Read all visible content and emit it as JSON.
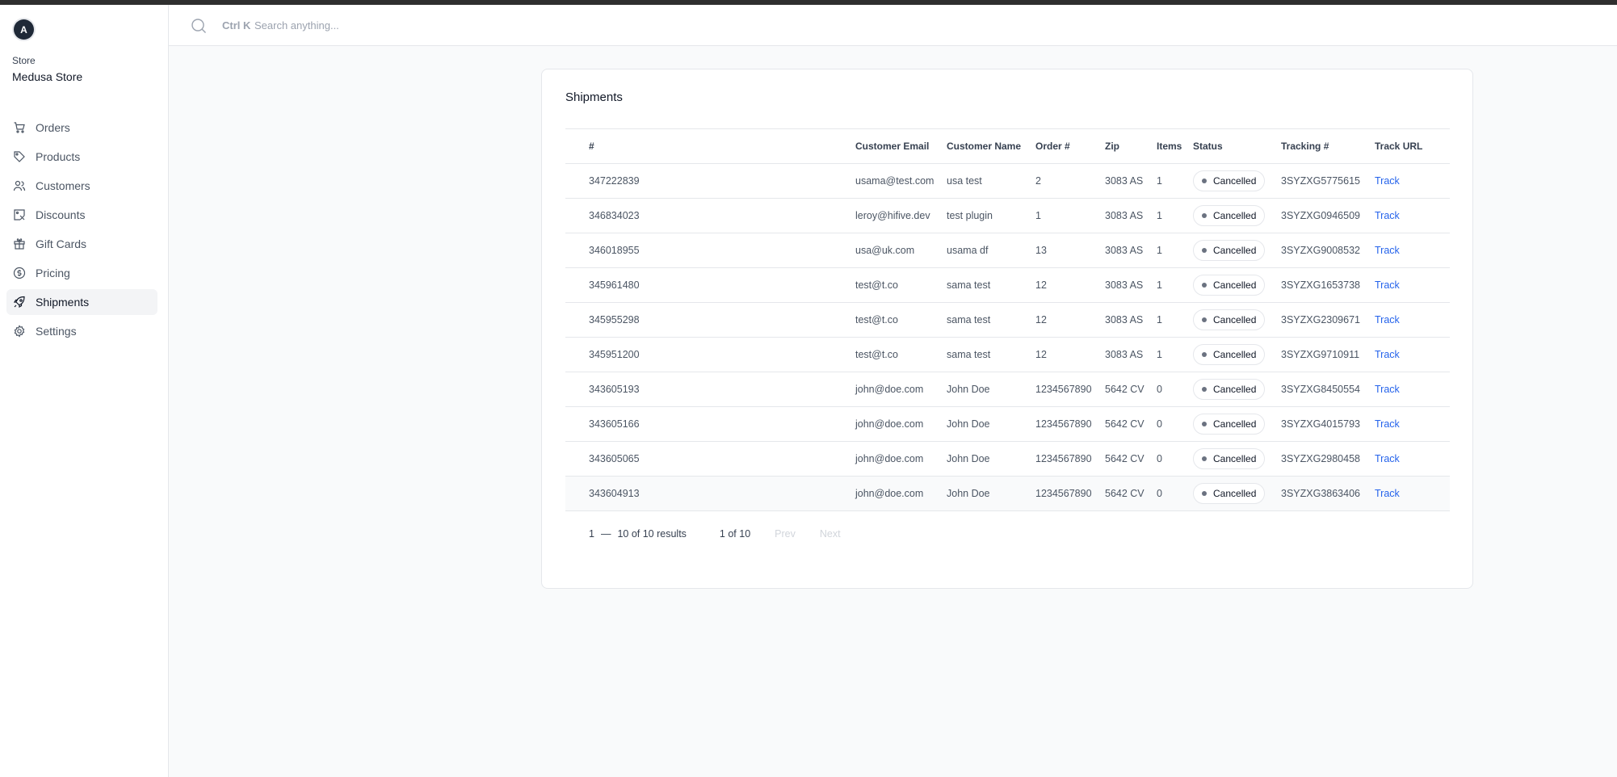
{
  "sidebar": {
    "avatar_letter": "A",
    "store_label": "Store",
    "store_name": "Medusa Store",
    "items": [
      {
        "label": "Orders",
        "icon": "cart-icon"
      },
      {
        "label": "Products",
        "icon": "tag-icon"
      },
      {
        "label": "Customers",
        "icon": "users-icon"
      },
      {
        "label": "Discounts",
        "icon": "discount-icon"
      },
      {
        "label": "Gift Cards",
        "icon": "gift-icon"
      },
      {
        "label": "Pricing",
        "icon": "dollar-icon"
      },
      {
        "label": "Shipments",
        "icon": "rocket-icon",
        "active": true
      },
      {
        "label": "Settings",
        "icon": "gear-icon"
      }
    ]
  },
  "search": {
    "shortcut": "Ctrl K",
    "placeholder": "Search anything..."
  },
  "card": {
    "title": "Shipments",
    "columns": [
      "#",
      "Customer Email",
      "Customer Name",
      "Order #",
      "Zip",
      "Items",
      "Status",
      "Tracking #",
      "Track URL"
    ],
    "rows": [
      {
        "id": "347222839",
        "email": "usama@test.com",
        "name": "usa test",
        "order": "2",
        "zip": "3083 AS",
        "items": "1",
        "status": "Cancelled",
        "tracking": "3SYZXG5775615",
        "track": "Track"
      },
      {
        "id": "346834023",
        "email": "leroy@hifive.dev",
        "name": "test plugin",
        "order": "1",
        "zip": "3083 AS",
        "items": "1",
        "status": "Cancelled",
        "tracking": "3SYZXG0946509",
        "track": "Track"
      },
      {
        "id": "346018955",
        "email": "usa@uk.com",
        "name": "usama df",
        "order": "13",
        "zip": "3083 AS",
        "items": "1",
        "status": "Cancelled",
        "tracking": "3SYZXG9008532",
        "track": "Track"
      },
      {
        "id": "345961480",
        "email": "test@t.co",
        "name": "sama test",
        "order": "12",
        "zip": "3083 AS",
        "items": "1",
        "status": "Cancelled",
        "tracking": "3SYZXG1653738",
        "track": "Track"
      },
      {
        "id": "345955298",
        "email": "test@t.co",
        "name": "sama test",
        "order": "12",
        "zip": "3083 AS",
        "items": "1",
        "status": "Cancelled",
        "tracking": "3SYZXG2309671",
        "track": "Track"
      },
      {
        "id": "345951200",
        "email": "test@t.co",
        "name": "sama test",
        "order": "12",
        "zip": "3083 AS",
        "items": "1",
        "status": "Cancelled",
        "tracking": "3SYZXG9710911",
        "track": "Track"
      },
      {
        "id": "343605193",
        "email": "john@doe.com",
        "name": "John Doe",
        "order": "1234567890",
        "zip": "5642 CV",
        "items": "0",
        "status": "Cancelled",
        "tracking": "3SYZXG8450554",
        "track": "Track"
      },
      {
        "id": "343605166",
        "email": "john@doe.com",
        "name": "John Doe",
        "order": "1234567890",
        "zip": "5642 CV",
        "items": "0",
        "status": "Cancelled",
        "tracking": "3SYZXG4015793",
        "track": "Track"
      },
      {
        "id": "343605065",
        "email": "john@doe.com",
        "name": "John Doe",
        "order": "1234567890",
        "zip": "5642 CV",
        "items": "0",
        "status": "Cancelled",
        "tracking": "3SYZXG2980458",
        "track": "Track"
      },
      {
        "id": "343604913",
        "email": "john@doe.com",
        "name": "John Doe",
        "order": "1234567890",
        "zip": "5642 CV",
        "items": "0",
        "status": "Cancelled",
        "tracking": "3SYZXG3863406",
        "track": "Track"
      }
    ]
  },
  "pagination": {
    "range_start": "1",
    "range_sep": "—",
    "range_end": "10 of 10 results",
    "pages": "1 of 10",
    "prev": "Prev",
    "next": "Next"
  }
}
